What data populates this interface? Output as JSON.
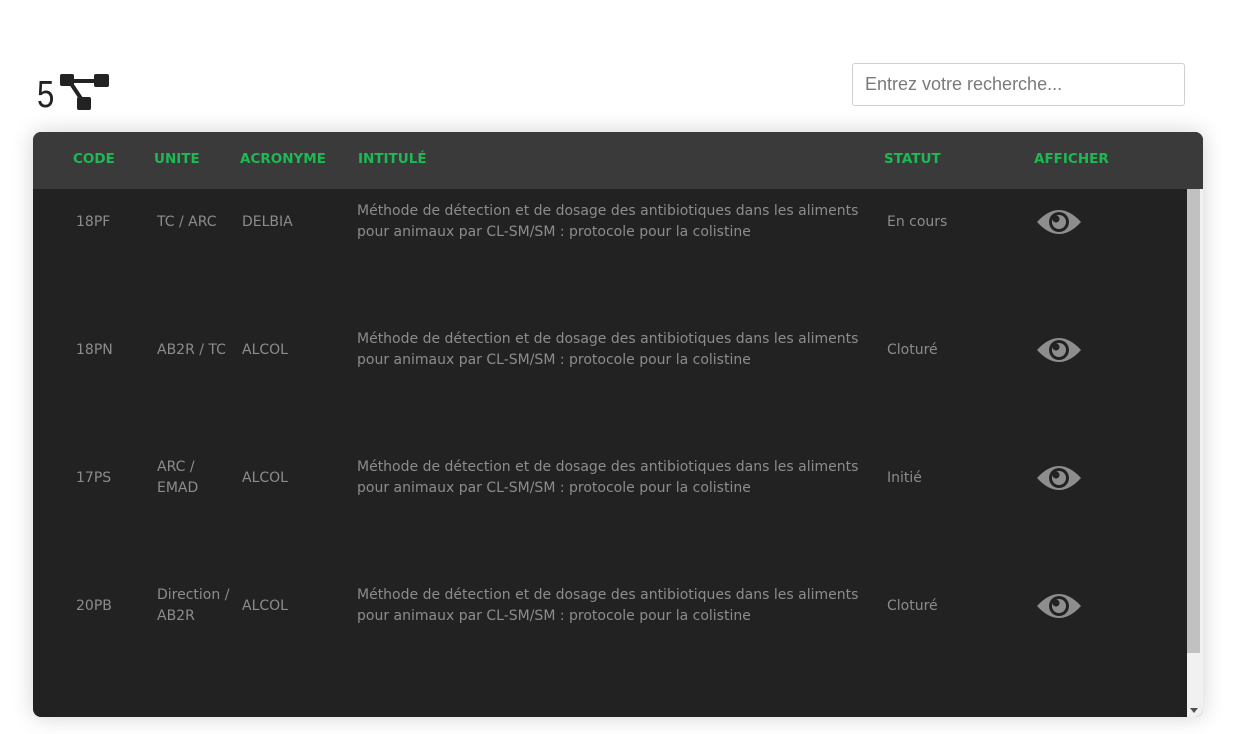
{
  "header": {
    "count": "5",
    "tree_icon": "hierarchy-tree-icon"
  },
  "search": {
    "placeholder": "Entrez votre recherche..."
  },
  "table": {
    "columns": [
      "CODE",
      "UNITE",
      "ACRONYME",
      "INTITULÉ",
      "STATUT",
      "AFFICHER"
    ],
    "rows": [
      {
        "code": "18PF",
        "unite": "TC / ARC",
        "acronyme": "DELBIA",
        "intitule": "Méthode de détection et de dosage des antibiotiques dans les aliments pour animaux par CL-SM/SM : protocole pour la colistine",
        "statut": "En cours",
        "icon": "eye-icon"
      },
      {
        "code": "18PN",
        "unite": "AB2R / TC",
        "acronyme": "ALCOL",
        "intitule": "Méthode de détection et de dosage des antibiotiques dans les aliments pour animaux par CL-SM/SM : protocole pour la colistine",
        "statut": "Cloturé",
        "icon": "eye-icon"
      },
      {
        "code": "17PS",
        "unite": "ARC / EMAD",
        "acronyme": "ALCOL",
        "intitule": "Méthode de détection et de dosage des antibiotiques dans les aliments pour animaux par CL-SM/SM : protocole pour la colistine",
        "statut": "Initié",
        "icon": "eye-icon"
      },
      {
        "code": "20PB",
        "unite": "Direction / AB2R",
        "acronyme": "ALCOL",
        "intitule": "Méthode de détection et de dosage des antibiotiques dans les aliments pour animaux par CL-SM/SM : protocole pour la colistine",
        "statut": "Cloturé",
        "icon": "eye-icon"
      }
    ]
  },
  "colors": {
    "accent": "#1db954",
    "panel_bg": "#222222",
    "header_bg": "#3a3a3a",
    "cell_text": "#8c8c8c"
  }
}
